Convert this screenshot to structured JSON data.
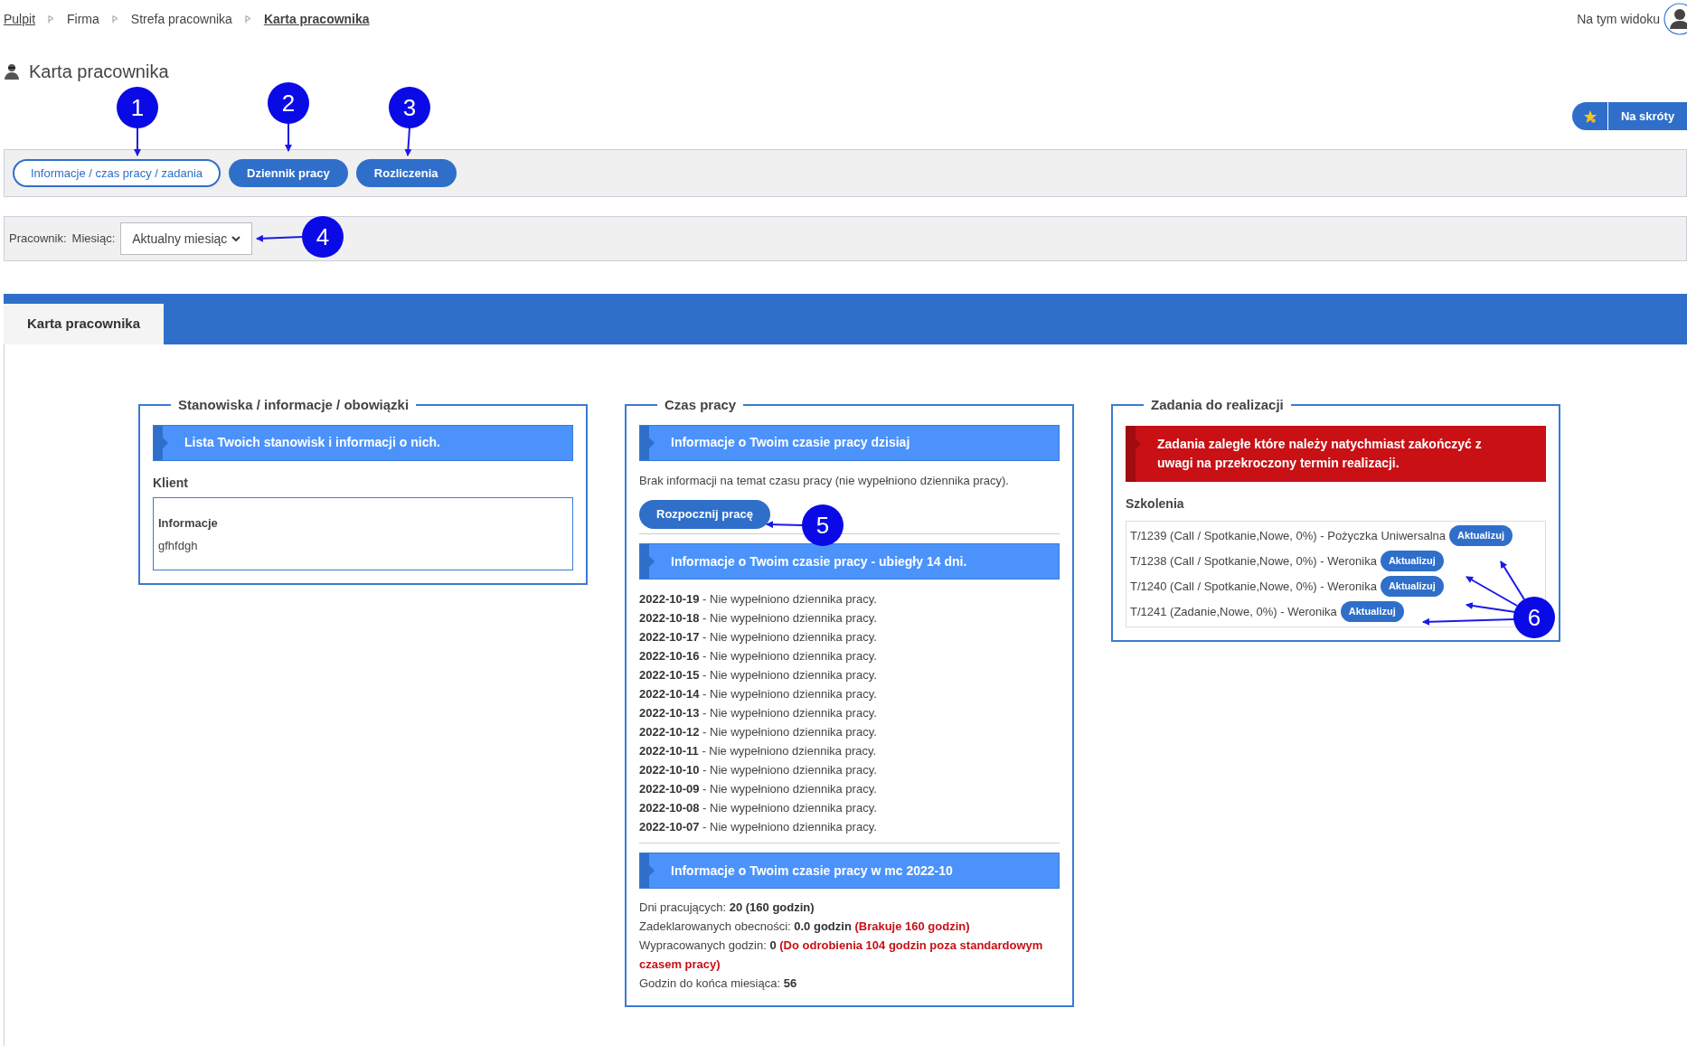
{
  "breadcrumb": [
    {
      "label": "Pulpit",
      "kind": "link"
    },
    {
      "label": "Firma",
      "kind": "plain"
    },
    {
      "label": "Strefa pracownika",
      "kind": "plain"
    },
    {
      "label": "Karta pracownika",
      "kind": "current"
    }
  ],
  "view_menu": {
    "label": "Na tym widoku"
  },
  "page_title": "Karta pracownika",
  "shortcuts_button": "Na skróty",
  "tabs": [
    {
      "label": "Informacje / czas pracy / zadania",
      "selected": true
    },
    {
      "label": "Dziennik pracy",
      "selected": false
    },
    {
      "label": "Rozliczenia",
      "selected": false
    }
  ],
  "filter": {
    "employee_label": "Pracownik:",
    "month_label": "Miesiąc:",
    "month_value": "Aktualny miesiąc"
  },
  "card_tab": "Karta pracownika",
  "positions_panel": {
    "title": "Stanowiska / informacje / obowiązki",
    "header": "Lista Twoich stanowisk i informacji o nich.",
    "client_label": "Klient",
    "info_title": "Informacje",
    "info_text": "gfhfdgh"
  },
  "work_time_panel": {
    "title": "Czas pracy",
    "today_header": "Informacje o Twoim czasie pracy dzisiaj",
    "today_text": "Brak informacji na temat czasu pracy (nie wypełniono dziennika pracy).",
    "start_button": "Rozpocznij pracę",
    "past_header": "Informacje o Twoim czasie pracy - ubiegły 14 dni.",
    "past_days": [
      {
        "date": "2022-10-19",
        "text": " - Nie wypełniono dziennika pracy."
      },
      {
        "date": "2022-10-18",
        "text": " - Nie wypełniono dziennika pracy."
      },
      {
        "date": "2022-10-17",
        "text": " - Nie wypełniono dziennika pracy."
      },
      {
        "date": "2022-10-16",
        "text": " - Nie wypełniono dziennika pracy."
      },
      {
        "date": "2022-10-15",
        "text": " - Nie wypełniono dziennika pracy."
      },
      {
        "date": "2022-10-14",
        "text": " - Nie wypełniono dziennika pracy."
      },
      {
        "date": "2022-10-13",
        "text": " - Nie wypełniono dziennika pracy."
      },
      {
        "date": "2022-10-12",
        "text": " - Nie wypełniono dziennika pracy."
      },
      {
        "date": "2022-10-11",
        "text": " - Nie wypełniono dziennika pracy."
      },
      {
        "date": "2022-10-10",
        "text": " - Nie wypełniono dziennika pracy."
      },
      {
        "date": "2022-10-09",
        "text": " - Nie wypełniono dziennika pracy."
      },
      {
        "date": "2022-10-08",
        "text": " - Nie wypełniono dziennika pracy."
      },
      {
        "date": "2022-10-07",
        "text": " - Nie wypełniono dziennika pracy."
      }
    ],
    "month_header": "Informacje o Twoim czasie pracy w mc 2022-10",
    "month_stats": [
      {
        "label": "Dni pracujących: ",
        "value": "20 (160 godzin)"
      },
      {
        "label": "Zadeklarowanych obecności: ",
        "value": "0.0 godzin",
        "note": " (Brakuje 160 godzin)"
      },
      {
        "label": "Wypracowanych godzin: ",
        "value": "0",
        "note": " (Do odrobienia 104 godzin poza standardowym czasem pracy)"
      },
      {
        "label": "Godzin do końca miesiąca: ",
        "value": "56"
      }
    ]
  },
  "tasks_panel": {
    "title": "Zadania do realizacji",
    "alert": "Zadania zaległe które należy natychmiast zakończyć z uwagi na przekroczony termin realizacji.",
    "section_label": "Szkolenia",
    "tasks": [
      {
        "text": "T/1239 (Call / Spotkanie,Nowe, 0%) - Pożyczka Uniwersalna",
        "button": "Aktualizuj"
      },
      {
        "text": "T/1238 (Call / Spotkanie,Nowe, 0%) - Weronika",
        "button": "Aktualizuj"
      },
      {
        "text": "T/1240 (Call / Spotkanie,Nowe, 0%) - Weronika",
        "button": "Aktualizuj"
      },
      {
        "text": "T/1241 (Zadanie,Nowe, 0%) - Weronika",
        "button": "Aktualizuj"
      }
    ]
  },
  "callouts": [
    {
      "number": "1"
    },
    {
      "number": "2"
    },
    {
      "number": "3"
    },
    {
      "number": "4"
    },
    {
      "number": "5"
    },
    {
      "number": "6"
    }
  ]
}
